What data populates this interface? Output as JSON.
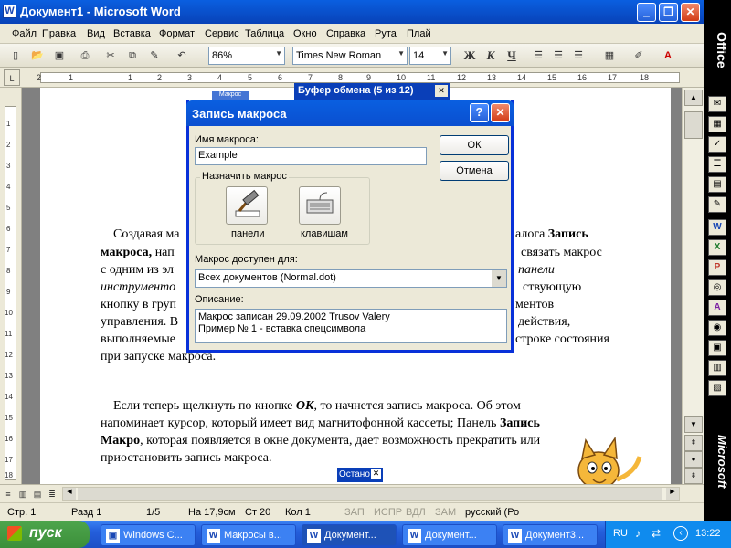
{
  "window": {
    "title": "Документ1 - Microsoft Word",
    "controls": [
      "_",
      "❐",
      "✕"
    ]
  },
  "menu": [
    "Файл",
    "Правка",
    "Вид",
    "Вставка",
    "Формат",
    "Сервис",
    "Таблица",
    "Окно",
    "Справка",
    "Рута",
    "Плай"
  ],
  "toolbar": {
    "zoom": "86%",
    "font": "Times New Roman",
    "size": "14",
    "bold": "Ж",
    "italic": "К",
    "underline": "Ч"
  },
  "ruler": {
    "labels": [
      "2",
      "1",
      "1",
      "2",
      "3",
      "4",
      "5",
      "6",
      "7",
      "8",
      "9",
      "10",
      "11",
      "12",
      "13",
      "14",
      "15",
      "16",
      "17",
      "18"
    ]
  },
  "vruler": {
    "labels": [
      "1",
      "2",
      "3",
      "4",
      "5",
      "6",
      "7",
      "8",
      "9",
      "10",
      "11",
      "12",
      "13",
      "14",
      "15",
      "16",
      "17",
      "18"
    ]
  },
  "document": {
    "para1_line1_left": "Создавая ма",
    "para1_line1_right": "алога",
    "para1_bold1": "Запись",
    "para1_line2_left_bold": "макроса,",
    "para1_line2_left": " нап",
    "para1_line2_right": "связать макрос",
    "para1_line3_left": "с одним из эл",
    "para1_line3_right_italic": "панели",
    "para1_line4_left_italic": "инструменто",
    "para1_line4_right": "ствующую",
    "para1_line5_left": "кнопку в груп",
    "para1_line5_right": "ментов",
    "para1_line6_left": "управления. В",
    "para1_line6_right": "действия,",
    "para1_line7_left": "выполняемые",
    "para1_line7_right": "строке состояния",
    "para1_line8": "при запуске макроса.",
    "para2_l1a": "Если теперь щелкнуть по кнопке ",
    "para2_l1b": "ОК",
    "para2_l1c": ", то начнется запись макроса. Об этом",
    "para2_l2a": "напоминает курсор, который имеет вид магнитофонной кассеты; Панель ",
    "para2_l2b": "Запись",
    "para2_l3a": "Макро",
    "para2_l3b": ", которая появляется в окне документа, дает возможность прекратить или",
    "para2_l4": "приостановить запись макроса."
  },
  "stop_toolbar": {
    "label": "Остано"
  },
  "tiny_label": "Макрос",
  "clipboard": {
    "title": "Буфер обмена (5 из 12)"
  },
  "dialog": {
    "title": "Запись макроса",
    "name_label": "Имя макроса:",
    "name_value": "Example",
    "ok": "ОК",
    "cancel": "Отмена",
    "assign_group": "Назначить макрос",
    "toolbars_btn": "панели",
    "keyboard_btn": "клавишам",
    "store_label": "Макрос доступен для:",
    "store_value": "Всех документов (Normal.dot)",
    "desc_label": "Описание:",
    "desc_line1": "Макрос записан 29.09.2002 Trusov Valery",
    "desc_line2": "Пример № 1 - вставка спецсимвола"
  },
  "status": {
    "page": "Стр. 1",
    "section": "Разд 1",
    "pages": "1/5",
    "pos": "На 17,9см",
    "line": "Ст 20",
    "col": "Кол 1",
    "rec": "ЗАП",
    "trk": "ИСПР",
    "ext": "ВДЛ",
    "ovr": "ЗАМ",
    "lang": "русский (Ро"
  },
  "officebar": {
    "label": "Office",
    "brand": "Microsoft"
  },
  "taskbar": {
    "start": "пуск",
    "tasks": [
      "Windows C...",
      "Макросы в...",
      "Документ...",
      "Документ...",
      "Документ3..."
    ],
    "lang": "RU",
    "time": "13:22"
  }
}
